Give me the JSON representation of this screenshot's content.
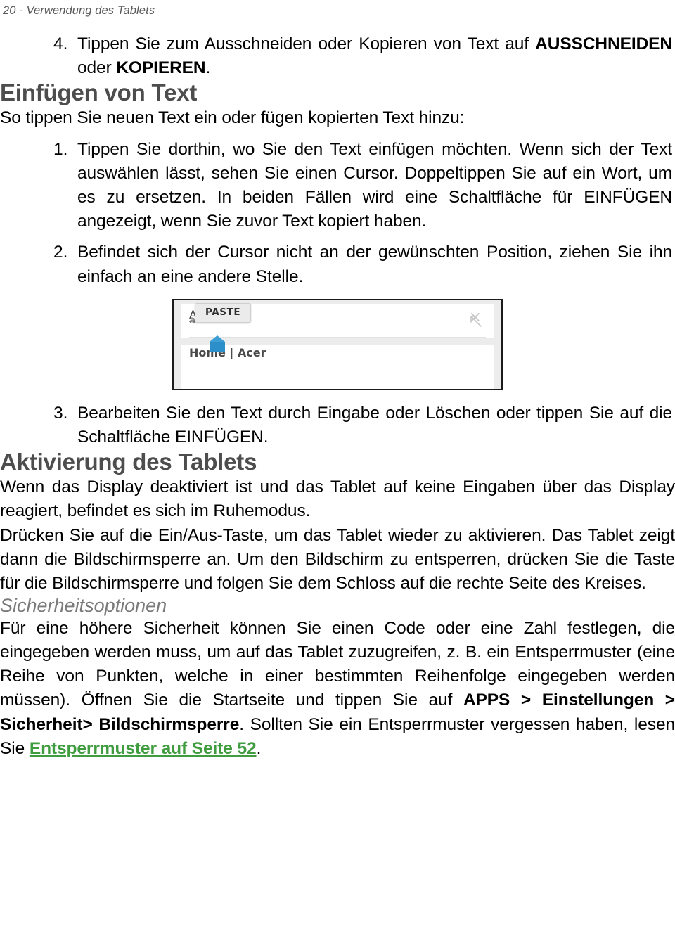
{
  "page": {
    "running_header": "20 - Verwendung des Tablets"
  },
  "items": {
    "item4": {
      "marker": "4.",
      "text_before": "Tippen Sie zum Ausschneiden oder Kopieren von Text auf ",
      "bold_1": "AUSSCHNEIDEN",
      "mid": " oder ",
      "bold_2": "KOPIEREN",
      "text_after": "."
    },
    "item1": {
      "marker": "1.",
      "text": "Tippen Sie dorthin, wo Sie den Text einfügen möchten. Wenn sich der Text auswählen lässt, sehen Sie einen Cursor. Doppeltippen Sie auf ein Wort, um es zu ersetzen. In beiden Fällen wird eine Schaltfläche für EINFÜGEN angezeigt, wenn Sie zuvor Text kopiert haben."
    },
    "item2": {
      "marker": "2.",
      "text": "Befindet sich der Cursor nicht an der gewünschten Position, ziehen Sie ihn einfach an eine andere Stelle."
    },
    "item3": {
      "marker": "3.",
      "text": "Bearbeiten Sie den Text durch Eingabe oder Löschen oder tippen Sie auf die Schaltfläche EINFÜGEN."
    }
  },
  "headings": {
    "einfuegen_von_text": "Einfügen von Text",
    "aktivierung_des_tablets": "Aktivierung des Tablets",
    "sicherheitsoptionen": "Sicherheitsoptionen"
  },
  "paragraphs": {
    "intro_einfuegen": "So tippen Sie neuen Text ein oder fügen kopierten Text hinzu:",
    "aktivierung_1": "Wenn das Display deaktiviert ist und das Tablet auf keine Eingaben über das Display reagiert, befindet es sich im Ruhemodus.",
    "aktivierung_2": "Drücken Sie auf die Ein/Aus-Taste, um das Tablet wieder zu aktivieren. Das Tablet zeigt dann die Bildschirmsperre an. Um den Bildschirm zu entsperren, drücken Sie die Taste für die Bildschirmsperre und folgen Sie dem Schloss auf die rechte Seite des Kreises."
  },
  "security_paragraph": {
    "part_1": "Für eine höhere Sicherheit können Sie einen Code oder eine Zahl festlegen, die eingegeben werden muss, um auf das Tablet zuzugreifen, z. B. ein Entsperrmuster (eine Reihe von Punkten, welche in einer bestimmten Reihenfolge eingegeben werden müssen). Öffnen Sie die Startseite und tippen Sie auf ",
    "bold_apps": "APPS",
    "sep_1": " > ",
    "bold_einstellungen": "Einstellungen",
    "sep_2": " > ",
    "bold_sicherheit": "Sicherheit>",
    "sep_3": " ",
    "bold_bildschirmsperre": "Bildschirmsperre",
    "part_2": ". Sollten Sie ein Entsperrmuster vergessen haben, lesen Sie ",
    "link_text": "Entsperrmuster auf Seite 52",
    "part_3": "."
  },
  "figure": {
    "paste_button": "PASTE",
    "typed_text": "Acer",
    "suggestion_text": "acer",
    "result_text": "Home | Acer",
    "close_icon": "×",
    "colors": {
      "handle_blue": "#2d8fc9",
      "handle_tip_blue": "#3b9fd6",
      "border": "#1b1b1b",
      "background": "#ececec"
    }
  },
  "colors": {
    "heading_gray": "#4d4d4d",
    "subheading_gray": "#7a7a7a",
    "running_header_gray": "#595959",
    "link_green": "#3f9c3f",
    "body_black": "#000000"
  }
}
